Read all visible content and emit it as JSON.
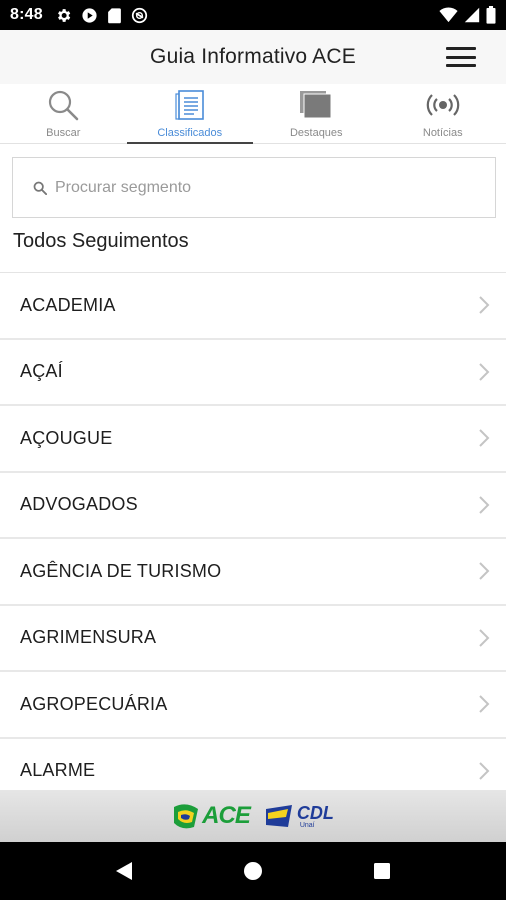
{
  "status_bar": {
    "time": "8:48",
    "left_icons": [
      "gear-icon",
      "play-store-icon",
      "sd-card-icon",
      "no-disturb-icon"
    ],
    "right_icons": [
      "wifi-icon",
      "signal-icon",
      "battery-icon"
    ]
  },
  "app_bar": {
    "title": "Guia Informativo ACE",
    "menu_icon": "hamburger-menu-icon"
  },
  "tabs": [
    {
      "label": "Buscar",
      "icon": "search-icon",
      "active": false
    },
    {
      "label": "Classificados",
      "icon": "list-document-icon",
      "active": true
    },
    {
      "label": "Destaques",
      "icon": "stacked-squares-icon",
      "active": false
    },
    {
      "label": "Notícias",
      "icon": "broadcast-icon",
      "active": false
    }
  ],
  "search": {
    "placeholder": "Procurar segmento",
    "value": ""
  },
  "section_title": "Todos Seguimentos",
  "segments": [
    {
      "label": "ACADEMIA"
    },
    {
      "label": "AÇAÍ"
    },
    {
      "label": "AÇOUGUE"
    },
    {
      "label": "ADVOGADOS"
    },
    {
      "label": "AGÊNCIA DE TURISMO"
    },
    {
      "label": "AGRIMENSURA"
    },
    {
      "label": "AGROPECUÁRIA"
    },
    {
      "label": "ALARME"
    }
  ],
  "footer": {
    "logo_ace": "ACE",
    "logo_cdl": "CDL",
    "logo_cdl_sub": "Unaí"
  },
  "colors": {
    "accent": "#4a8cd8",
    "tab_indicator": "#444444",
    "ace_green": "#1c9e3a",
    "ace_yellow": "#f4d21f",
    "cdl_blue": "#1f3c99"
  },
  "nav_bar": [
    "back-icon",
    "home-icon",
    "recents-icon"
  ]
}
